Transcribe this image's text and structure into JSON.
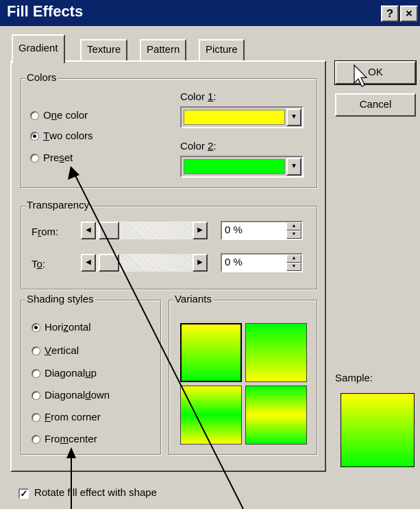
{
  "window": {
    "title": "Fill Effects",
    "help_label": "?",
    "close_label": "×"
  },
  "tabs": [
    {
      "label": "Gradient",
      "active": true
    },
    {
      "label": "Texture",
      "active": false
    },
    {
      "label": "Pattern",
      "active": false
    },
    {
      "label": "Picture",
      "active": false
    }
  ],
  "colors": {
    "group_label": "Colors",
    "radios": [
      {
        "pre": "O",
        "key": "n",
        "post": "e color",
        "checked": false
      },
      {
        "pre": "",
        "key": "T",
        "post": "wo colors",
        "checked": true
      },
      {
        "pre": "Pre",
        "key": "s",
        "post": "et",
        "checked": false
      }
    ],
    "color1": {
      "pre": "Color ",
      "key": "1",
      "post": ":",
      "value": "#ffff00"
    },
    "color2": {
      "pre": "Color ",
      "key": "2",
      "post": ":",
      "value": "#00ff00"
    }
  },
  "transparency": {
    "group_label": "Transparency",
    "from": {
      "pre": "F",
      "key": "r",
      "post": "om:",
      "value": "0 %"
    },
    "to": {
      "pre": "T",
      "key": "o",
      "post": ":",
      "value": "0 %"
    }
  },
  "shading": {
    "group_label": "Shading styles",
    "radios": [
      {
        "pre": "Hori",
        "key": "z",
        "post": "ontal",
        "checked": true
      },
      {
        "pre": "",
        "key": "V",
        "post": "ertical",
        "checked": false
      },
      {
        "pre": "Diagonal ",
        "key": "u",
        "post": "p",
        "checked": false
      },
      {
        "pre": "Diagonal ",
        "key": "d",
        "post": "own",
        "checked": false
      },
      {
        "pre": "",
        "key": "F",
        "post": "rom corner",
        "checked": false
      },
      {
        "pre": "Fro",
        "key": "m",
        "post": " center",
        "checked": false
      }
    ]
  },
  "variants": {
    "group_label": "Variants"
  },
  "buttons": {
    "ok_label": "OK",
    "cancel_label": "Cancel"
  },
  "sample": {
    "label": "Sample:"
  },
  "rotate": {
    "label": "Rotate fill effect with shape",
    "checked": true,
    "check_mark": "✓"
  },
  "icons": {
    "arrow_down": "▼",
    "arrow_left": "◀",
    "arrow_right": "▶",
    "arrow_up": "▲"
  }
}
